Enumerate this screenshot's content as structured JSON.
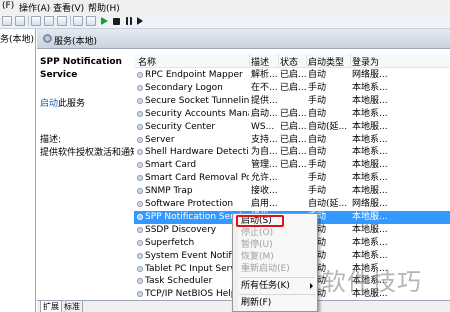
{
  "menu": {
    "file": "(F)",
    "action": "操作(A)",
    "view": "查看(V)",
    "help": "帮助(H)"
  },
  "left": {
    "heading": "务(本地)"
  },
  "header": {
    "title": "服务(本地)"
  },
  "detail": {
    "service_name": "SPP Notification\nService",
    "start_link": "启动",
    "start_suffix": "此服务",
    "desc_label": "描述:",
    "desc_text": "提供软件授权激活和通知"
  },
  "columns": {
    "name": "名称",
    "desc": "描述",
    "status": "状态",
    "startup": "启动类型",
    "logon": "登录为"
  },
  "services": [
    {
      "name": "RPC Endpoint Mapper",
      "desc": "解析...",
      "status": "已启...",
      "startup": "自动",
      "logon": "网络服..."
    },
    {
      "name": "Secondary Logon",
      "desc": "在不...",
      "status": "已启...",
      "startup": "手动",
      "logon": "本地系..."
    },
    {
      "name": "Secure Socket Tunneling ...",
      "desc": "提供...",
      "status": "",
      "startup": "手动",
      "logon": "本地服..."
    },
    {
      "name": "Security Accounts Mana...",
      "desc": "启动...",
      "status": "已启...",
      "startup": "自动",
      "logon": "本地系..."
    },
    {
      "name": "Security Center",
      "desc": "WS...",
      "status": "已启...",
      "startup": "自动(延...",
      "logon": "本地服..."
    },
    {
      "name": "Server",
      "desc": "支持...",
      "status": "已启...",
      "startup": "自动",
      "logon": "本地系..."
    },
    {
      "name": "Shell Hardware Detection",
      "desc": "为自...",
      "status": "已启...",
      "startup": "自动",
      "logon": "本地系..."
    },
    {
      "name": "Smart Card",
      "desc": "管理...",
      "status": "已启...",
      "startup": "手动",
      "logon": "本地服..."
    },
    {
      "name": "Smart Card Removal Poli...",
      "desc": "允许...",
      "status": "",
      "startup": "手动",
      "logon": "本地系..."
    },
    {
      "name": "SNMP Trap",
      "desc": "接收...",
      "status": "",
      "startup": "手动",
      "logon": "本地服..."
    },
    {
      "name": "Software Protection",
      "desc": "启用...",
      "status": "",
      "startup": "自动(延...",
      "logon": "网络服..."
    },
    {
      "name": "SPP Notification Service",
      "desc": "提供...",
      "status": "",
      "startup": "手动",
      "logon": "本地服..."
    },
    {
      "name": "SSDP Discovery",
      "desc": "",
      "status": "",
      "startup": "手动",
      "logon": "本地服..."
    },
    {
      "name": "Superfetch",
      "desc": "",
      "status": "",
      "startup": "自动",
      "logon": "本地系..."
    },
    {
      "name": "System Event Notifica...",
      "desc": "",
      "status": "",
      "startup": "自动",
      "logon": "本地系..."
    },
    {
      "name": "Tablet PC Input Serv...",
      "desc": "",
      "status": "",
      "startup": "手动",
      "logon": "本地系..."
    },
    {
      "name": "Task Scheduler",
      "desc": "",
      "status": "",
      "startup": "自动",
      "logon": "本地系..."
    },
    {
      "name": "TCP/IP NetBIOS Help...",
      "desc": "",
      "status": "",
      "startup": "自动",
      "logon": "本地服..."
    }
  ],
  "context_menu": {
    "start": "启动(S)",
    "stop": "停止(O)",
    "pause": "暂停(U)",
    "resume": "恢复(M)",
    "restart": "重新启动(E)",
    "all_tasks": "所有任务(K)",
    "refresh": "刷新(F)"
  },
  "tabs": {
    "extended": "扩展",
    "standard": "标准"
  },
  "watermark": "软件技巧",
  "colors": {
    "selection": "#3399ff",
    "highlight_box": "#e0101a",
    "link": "#1a5fb4"
  }
}
